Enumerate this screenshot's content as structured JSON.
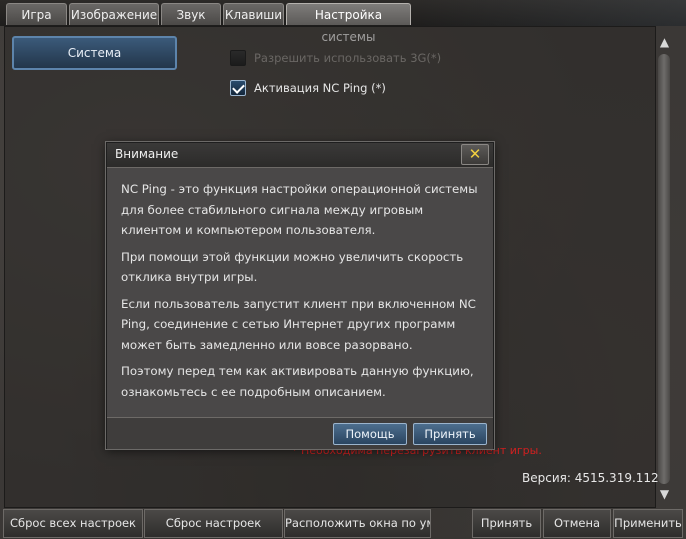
{
  "tabs": [
    {
      "label": "Игра"
    },
    {
      "label": "Изображение"
    },
    {
      "label": "Звук"
    },
    {
      "label": "Клавиши"
    },
    {
      "label": "Настройка системы",
      "active": true
    }
  ],
  "sidebar": {
    "items": [
      {
        "label": "Система",
        "selected": true
      }
    ]
  },
  "options": {
    "allow_3g": {
      "label": "Разрешить использовать 3G(*)",
      "checked": false,
      "enabled": false
    },
    "nc_ping": {
      "label": "Активация NC Ping (*)",
      "checked": true,
      "enabled": true
    }
  },
  "warning_text": "* Необходима перезагрузить клиент игры.",
  "version_text": "Версия: 4515.319.112",
  "bottom_bar": {
    "reset_all": "Сброс всех настроек",
    "reset": "Сброс настроек",
    "arrange_windows": "Расположить окна по умолча",
    "apply": "Принять",
    "cancel": "Отмена",
    "apply_settings": "Применить"
  },
  "dialog": {
    "title": "Внимание",
    "close_glyph": "✕",
    "paragraphs": [
      "NC Ping - это функция настройки операционной системы для более стабильного сигнала между игровым клиентом и компьютером пользователя.",
      "При помощи этой функции можно увеличить скорость отклика внутри игры.",
      "Если пользователь запустит клиент при включенном NC Ping, соединение с сетью Интернет других программ может быть замедленно или вовсе разорвано.",
      "Поэтому перед тем как активировать данную функцию, ознакомьтесь с ее подробным описанием."
    ],
    "help_button": "Помощь",
    "accept_button": "Принять"
  },
  "colors": {
    "accent_blue": "#3b5a7a",
    "warning_red": "#d02020",
    "close_yellow": "#f2d040"
  },
  "icons": {
    "scroll_up": "▲",
    "scroll_down": "▼"
  }
}
